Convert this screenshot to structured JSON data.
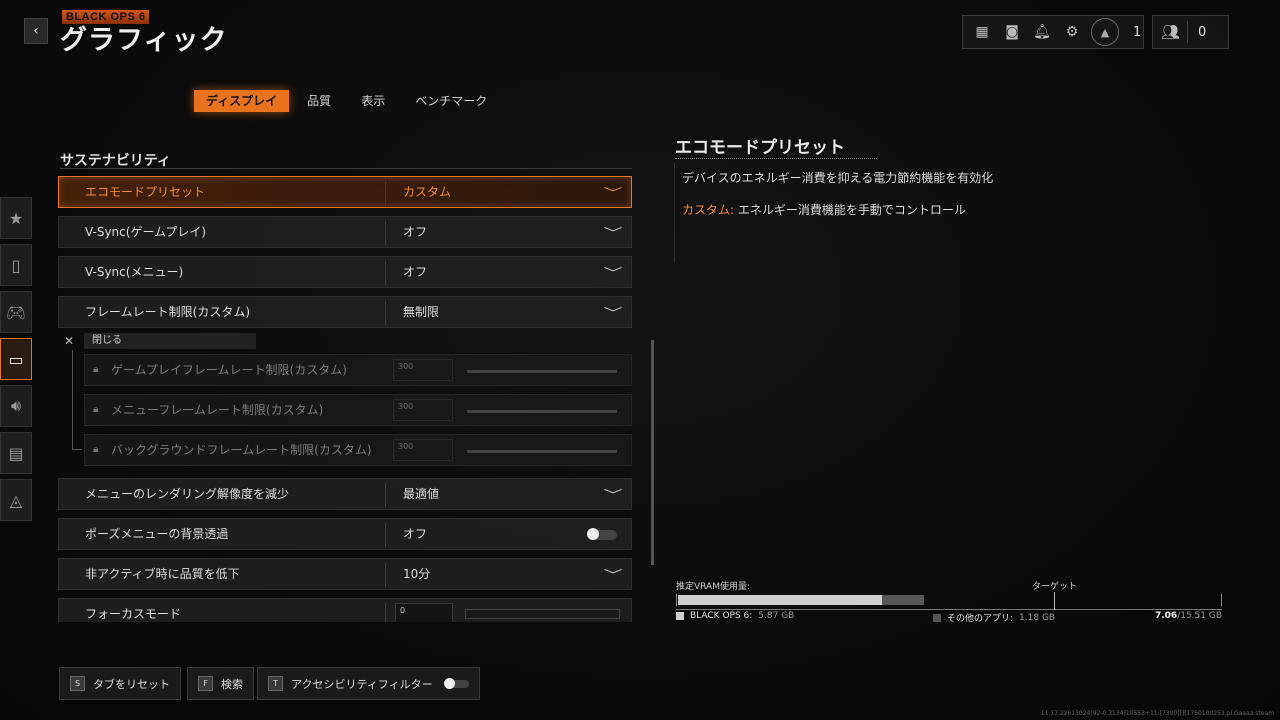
{
  "header": {
    "back_icon": "‹",
    "logo": "BLACK OPS 6",
    "title": "グラフィック",
    "top_icons": [
      "grid-icon",
      "theater-icon",
      "bell-icon",
      "gear-icon",
      "rank-icon"
    ],
    "player_level": "1",
    "friends_count": "0"
  },
  "tabs": [
    {
      "label": "ディスプレイ",
      "active": true
    },
    {
      "label": "品質",
      "active": false
    },
    {
      "label": "表示",
      "active": false
    },
    {
      "label": "ベンチマーク",
      "active": false
    }
  ],
  "sidebar": [
    "star-icon",
    "mouse-icon",
    "gamepad-icon",
    "monitor-icon",
    "speaker-icon",
    "interface-icon",
    "network-icon"
  ],
  "section": {
    "title": "サステナビリティ"
  },
  "settings": [
    {
      "label": "エコモードプリセット",
      "value": "カスタム",
      "control": "dropdown",
      "selected": true
    },
    {
      "label": "V-Sync(ゲームプレイ)",
      "value": "オフ",
      "control": "dropdown"
    },
    {
      "label": "V-Sync(メニュー)",
      "value": "オフ",
      "control": "dropdown"
    },
    {
      "label": "フレームレート制限(カスタム)",
      "value": "無制限",
      "control": "dropdown"
    }
  ],
  "close_label": "閉じる",
  "sub_settings": [
    {
      "label": "ゲームプレイフレームレート制限(カスタム)",
      "value": "300"
    },
    {
      "label": "メニューフレームレート制限(カスタム)",
      "value": "300"
    },
    {
      "label": "バックグラウンドフレームレート制限(カスタム)",
      "value": "300"
    }
  ],
  "settings2": [
    {
      "label": "メニューのレンダリング解像度を減少",
      "value": "最適値",
      "control": "dropdown"
    },
    {
      "label": "ポーズメニューの背景透過",
      "value": "オフ",
      "control": "toggle"
    },
    {
      "label": "非アクティブ時に品質を低下",
      "value": "10分",
      "control": "dropdown"
    },
    {
      "label": "フォーカスモード",
      "value": "0",
      "control": "slider"
    }
  ],
  "description": {
    "title": "エコモードプリセット",
    "text1": "デバイスのエネルギー消費を抑える電力節約機能を有効化",
    "highlight": "カスタム:",
    "text2": " エネルギー消費機能を手動でコントロール"
  },
  "vram": {
    "label": "推定VRAM使用量:",
    "target_label": "ターゲット",
    "game_name": "BLACK OPS 6:",
    "game_value": "5.87 GB",
    "other_name": "その他のアプリ:",
    "other_value": "1.18 GB",
    "total_used": "7.06",
    "total_capacity": "/15.51 GB",
    "colors": {
      "game": "#cfcfcf",
      "other": "#555555"
    }
  },
  "bottom": {
    "reset_key": "S",
    "reset_label": "タブをリセット",
    "search_key": "F",
    "search_label": "検索",
    "filter_key": "T",
    "filter_label": "アクセシビリティフィルター"
  },
  "build_info": "11.17.22613024[92-0.3134]10553+11:[7300][][1750100253.pl.Gaaaa.steam",
  "colors": {
    "accent": "#e8731e"
  }
}
